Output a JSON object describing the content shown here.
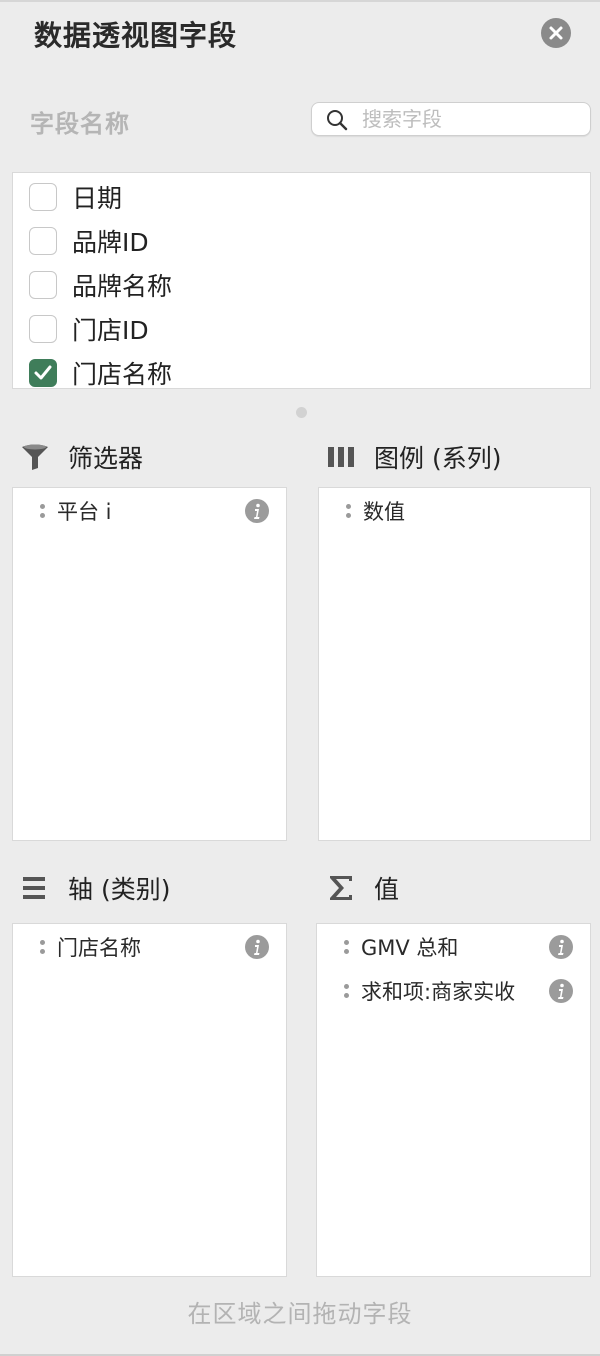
{
  "panel": {
    "title": "数据透视图字段",
    "close_icon": "close-circle-icon"
  },
  "fields": {
    "label": "字段名称",
    "search_placeholder": "搜索字段",
    "search_value": "",
    "items": [
      {
        "label": "日期",
        "checked": false
      },
      {
        "label": "品牌ID",
        "checked": false
      },
      {
        "label": "品牌名称",
        "checked": false
      },
      {
        "label": "门店ID",
        "checked": false
      },
      {
        "label": "门店名称",
        "checked": true
      }
    ]
  },
  "areas": {
    "filters": {
      "title": "筛选器",
      "icon": "filter-funnel-icon",
      "items": [
        {
          "label": "平台 i"
        }
      ]
    },
    "legend": {
      "title": "图例 (系列)",
      "icon": "columns-bars-icon",
      "items": [
        {
          "label": "数值"
        }
      ]
    },
    "axis": {
      "title": "轴 (类别)",
      "icon": "rows-lines-icon",
      "items": [
        {
          "label": "门店名称"
        }
      ]
    },
    "values": {
      "title": "值",
      "icon": "sigma-icon",
      "items": [
        {
          "label": "GMV 总和"
        },
        {
          "label": "求和项:商家实收"
        }
      ]
    }
  },
  "footer": {
    "hint": "在区域之间拖动字段"
  },
  "colors": {
    "background": "#ececec",
    "checkbox_checked": "#3f7d5a",
    "muted_text": "#b5b5b5"
  }
}
